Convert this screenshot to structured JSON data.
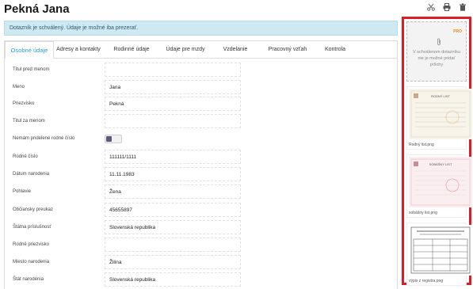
{
  "header": {
    "title": "Pekná Jana",
    "icons": [
      "scissors-icon",
      "print-icon",
      "trash-icon"
    ]
  },
  "notice": "Dotazník je schválený. Údaje je možné iba prezerať.",
  "tabs": [
    {
      "label": "Osobné údaje",
      "active": true
    },
    {
      "label": "Adresy a kontakty",
      "active": false
    },
    {
      "label": "Rodinné údaje",
      "active": false
    },
    {
      "label": "Údaje pre mzdy",
      "active": false
    },
    {
      "label": "Vzdelanie",
      "active": false
    },
    {
      "label": "Pracovný vzťah",
      "active": false
    },
    {
      "label": "Kontrola",
      "active": false
    }
  ],
  "form": {
    "titul_pred": {
      "label": "Titul pred menom",
      "value": ""
    },
    "meno": {
      "label": "Meno",
      "value": "Jana"
    },
    "priezvisko": {
      "label": "Priezvisko",
      "value": "Pekná"
    },
    "titul_za": {
      "label": "Titul za menom",
      "value": ""
    },
    "bez_rc": {
      "label": "Nemám pridelené rodné číslo",
      "value": false
    },
    "rodne_cislo": {
      "label": "Rodné číslo",
      "value": "111111/1111"
    },
    "datum_narodenia": {
      "label": "Dátum narodenia",
      "value": "11.11.1983"
    },
    "pohlavie": {
      "label": "Pohlavie",
      "value": "Žena"
    },
    "obciansky": {
      "label": "Občiansky preukaz",
      "value": "45655897"
    },
    "statna_prislusnost": {
      "label": "Štátna príslušnosť",
      "value": "Slovenská republika"
    },
    "rodne_priezvisko": {
      "label": "Rodné priezvisko",
      "value": ""
    },
    "miesto_narodenia": {
      "label": "Miesto narodenia",
      "value": "Žilina"
    },
    "stat_narodenia": {
      "label": "Štát narodenia",
      "value": "Slovenská republika"
    }
  },
  "attachments": {
    "pro_badge": "PRO",
    "upload_message": "V schválenom dotazníku nie je možné pridať prílohy",
    "files": [
      {
        "name": "Rodný list.png",
        "doc_title": "RODNÝ LIST"
      },
      {
        "name": "sobášny list.png",
        "doc_title": "SOBÁŠNY LIST"
      },
      {
        "name": "výpis z registra.png",
        "doc_title": ""
      }
    ]
  },
  "colors": {
    "accent": "#2a9fd8",
    "notice_bg": "#cfe9f2",
    "highlight_border": "#e01b24",
    "pro": "#e58a1c"
  }
}
